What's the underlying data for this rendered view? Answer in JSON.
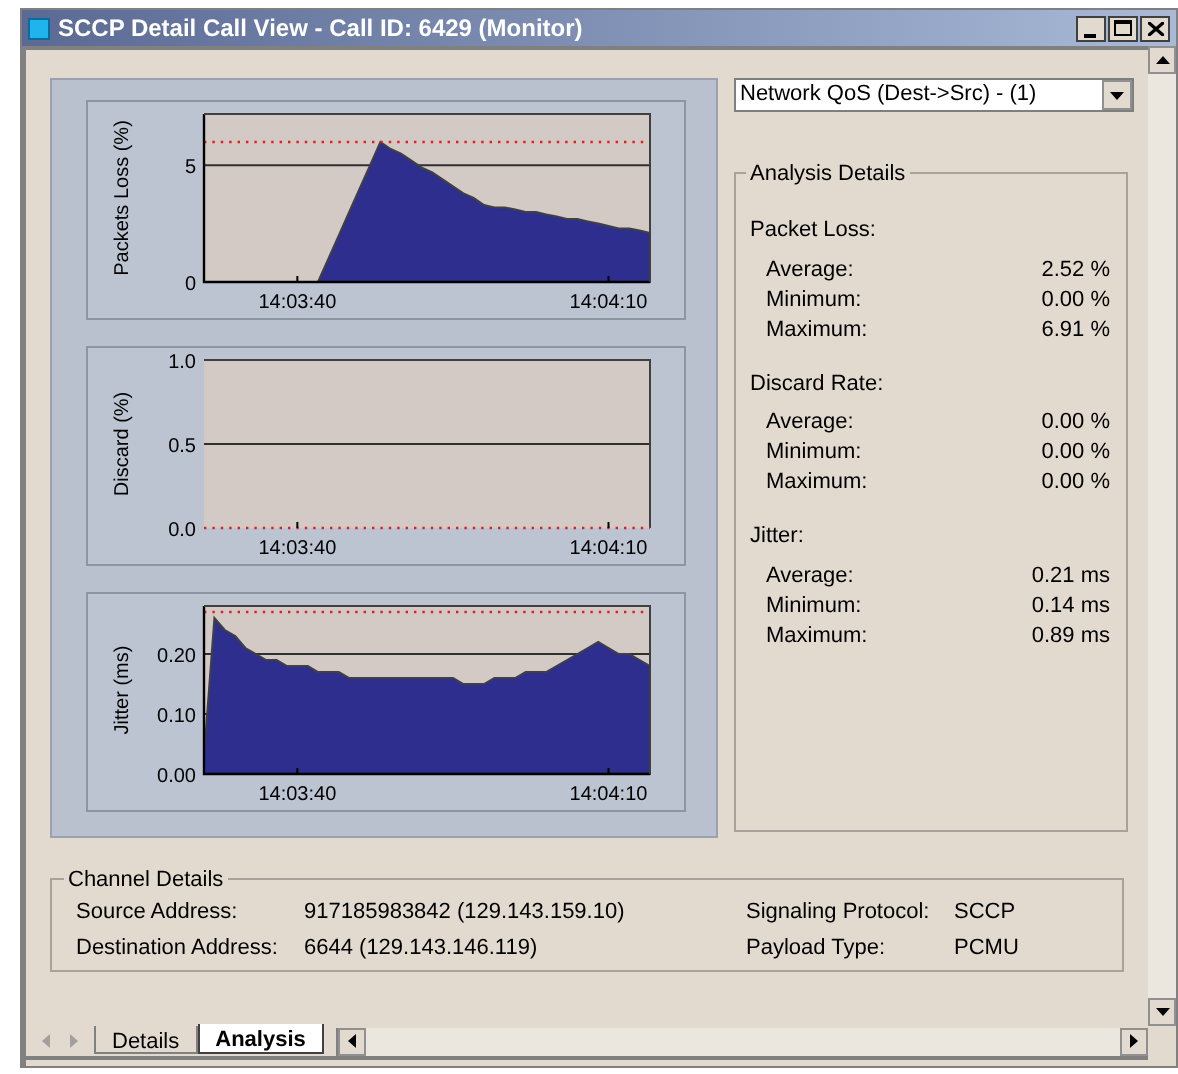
{
  "window": {
    "title": "SCCP Detail Call View - Call ID: 6429 (Monitor)"
  },
  "charts": [
    {
      "chart_data": {
        "type": "area",
        "ylabel": "Packets Loss (%)",
        "categories": [
          null,
          null,
          null,
          null,
          null,
          null,
          null,
          null,
          null,
          "14:03:40",
          null,
          null,
          null,
          null,
          null,
          null,
          null,
          null,
          null,
          null,
          null,
          null,
          null,
          null,
          null,
          null,
          null,
          null,
          null,
          null,
          null,
          null,
          null,
          null,
          null,
          null,
          null,
          null,
          null,
          "14:04:10",
          null,
          null,
          null,
          null
        ],
        "series": [
          {
            "color": "#2e2e8e",
            "values": [
              0,
              0,
              0,
              0,
              0,
              0,
              0,
              0,
              0,
              0,
              0,
              0,
              1.0,
              2.0,
              3.0,
              4.0,
              5.0,
              6.0,
              5.7,
              5.5,
              5.2,
              4.9,
              4.7,
              4.4,
              4.1,
              3.8,
              3.6,
              3.3,
              3.2,
              3.2,
              3.1,
              3.0,
              3.0,
              2.9,
              2.8,
              2.7,
              2.7,
              2.6,
              2.5,
              2.4,
              2.3,
              2.3,
              2.2,
              2.1
            ]
          }
        ],
        "ylim": [
          0,
          7.2
        ],
        "yticks": [
          0,
          5
        ],
        "ref_lines": [
          {
            "axis": "y",
            "value": 6.0
          }
        ]
      }
    },
    {
      "chart_data": {
        "type": "line",
        "ylabel": "Discard (%)",
        "categories": [
          null,
          null,
          null,
          null,
          null,
          null,
          null,
          null,
          null,
          "14:03:40",
          null,
          null,
          null,
          null,
          null,
          null,
          null,
          null,
          null,
          null,
          null,
          null,
          null,
          null,
          null,
          null,
          null,
          null,
          null,
          null,
          null,
          null,
          null,
          null,
          null,
          null,
          null,
          null,
          null,
          "14:04:10",
          null,
          null,
          null,
          null
        ],
        "series": [
          {
            "color": "#e02020",
            "line_style": "dotted",
            "values": [
              0,
              0,
              0,
              0,
              0,
              0,
              0,
              0,
              0,
              0,
              0,
              0,
              0,
              0,
              0,
              0,
              0,
              0,
              0,
              0,
              0,
              0,
              0,
              0,
              0,
              0,
              0,
              0,
              0,
              0,
              0,
              0,
              0,
              0,
              0,
              0,
              0,
              0,
              0,
              0,
              0,
              0,
              0,
              0
            ]
          }
        ],
        "ylim": [
          0,
          1
        ],
        "yticks": [
          {
            "value": 0,
            "label": "0.0"
          },
          {
            "value": 0.5,
            "label": "0.5"
          },
          {
            "value": 1,
            "label": "1.0"
          }
        ]
      }
    },
    {
      "chart_data": {
        "type": "area",
        "ylabel": "Jitter (ms)",
        "categories": [
          null,
          null,
          null,
          null,
          null,
          null,
          null,
          null,
          null,
          "14:03:40",
          null,
          null,
          null,
          null,
          null,
          null,
          null,
          null,
          null,
          null,
          null,
          null,
          null,
          null,
          null,
          null,
          null,
          null,
          null,
          null,
          null,
          null,
          null,
          null,
          null,
          null,
          null,
          null,
          null,
          "14:04:10",
          null,
          null,
          null,
          null
        ],
        "series": [
          {
            "color": "#2e2e8e",
            "values": [
              0.03,
              0.26,
              0.24,
              0.23,
              0.21,
              0.2,
              0.19,
              0.19,
              0.18,
              0.18,
              0.18,
              0.17,
              0.17,
              0.17,
              0.16,
              0.16,
              0.16,
              0.16,
              0.16,
              0.16,
              0.16,
              0.16,
              0.16,
              0.16,
              0.16,
              0.15,
              0.15,
              0.15,
              0.16,
              0.16,
              0.16,
              0.17,
              0.17,
              0.17,
              0.18,
              0.19,
              0.2,
              0.21,
              0.22,
              0.21,
              0.2,
              0.2,
              0.19,
              0.18
            ]
          }
        ],
        "ylim": [
          0,
          0.28
        ],
        "yticks": [
          {
            "value": 0,
            "label": "0.00"
          },
          {
            "value": 0.1,
            "label": "0.10"
          },
          {
            "value": 0.2,
            "label": "0.20"
          }
        ],
        "ref_lines": [
          {
            "axis": "y",
            "value": 0.27
          }
        ]
      }
    }
  ],
  "selector": {
    "value": "Network QoS (Dest->Src) - (1)"
  },
  "analysis": {
    "title": "Analysis Details",
    "groups": [
      {
        "label": "Packet Loss:",
        "rows": [
          {
            "label": "Average:",
            "value": "2.52 %"
          },
          {
            "label": "Minimum:",
            "value": "0.00 %"
          },
          {
            "label": "Maximum:",
            "value": "6.91 %"
          }
        ]
      },
      {
        "label": "Discard Rate:",
        "rows": [
          {
            "label": "Average:",
            "value": "0.00 %"
          },
          {
            "label": "Minimum:",
            "value": "0.00 %"
          },
          {
            "label": "Maximum:",
            "value": "0.00 %"
          }
        ]
      },
      {
        "label": "Jitter:",
        "rows": [
          {
            "label": "Average:",
            "value": "0.21 ms"
          },
          {
            "label": "Minimum:",
            "value": "0.14 ms"
          },
          {
            "label": "Maximum:",
            "value": "0.89 ms"
          }
        ]
      }
    ]
  },
  "channel": {
    "title": "Channel Details",
    "left": [
      {
        "label": "Source Address:",
        "value": "917185983842 (129.143.159.10)"
      },
      {
        "label": "Destination Address:",
        "value": "6644 (129.143.146.119)"
      }
    ],
    "right": [
      {
        "label": "Signaling Protocol:",
        "value": "SCCP"
      },
      {
        "label": "Payload Type:",
        "value": "PCMU"
      }
    ]
  },
  "tabs": [
    {
      "label": "Details",
      "selected": false
    },
    {
      "label": "Analysis",
      "selected": true
    }
  ]
}
